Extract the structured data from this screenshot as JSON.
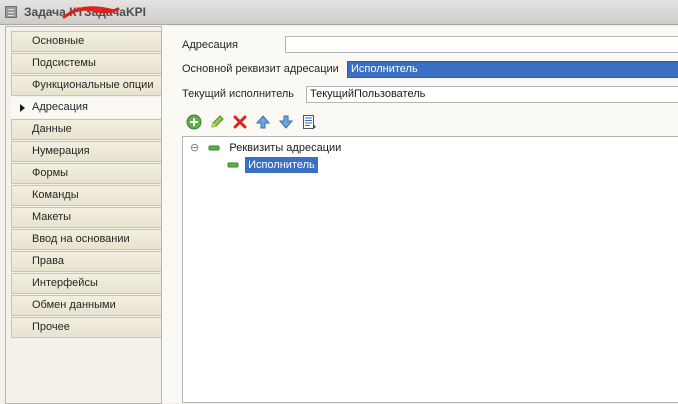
{
  "window": {
    "title_prefix": "Задача ",
    "title_struck": "КТ",
    "title_suffix": "ЗадачаKPI"
  },
  "nav": {
    "items": [
      {
        "label": "Основные"
      },
      {
        "label": "Подсистемы"
      },
      {
        "label": "Функциональные опции"
      },
      {
        "label": "Адресация"
      },
      {
        "label": "Данные"
      },
      {
        "label": "Нумерация"
      },
      {
        "label": "Формы"
      },
      {
        "label": "Команды"
      },
      {
        "label": "Макеты"
      },
      {
        "label": "Ввод на основании"
      },
      {
        "label": "Права"
      },
      {
        "label": "Интерфейсы"
      },
      {
        "label": "Обмен данными"
      },
      {
        "label": "Прочее"
      }
    ],
    "active": "Адресация"
  },
  "main": {
    "addressing_label": "Адресация",
    "addressing_value": "",
    "main_attr_label": "Основной реквизит адресации",
    "main_attr_value": "Исполнитель",
    "current_executor_label": "Текущий исполнитель",
    "current_executor_value": "ТекущийПользователь"
  },
  "toolbar": {
    "icons": [
      "add-icon",
      "edit-icon",
      "delete-icon",
      "move-up-icon",
      "move-down-icon",
      "list-icon"
    ]
  },
  "tree": {
    "root_label": "Реквизиты адресации",
    "child_label": "Исполнитель",
    "root_toggle": "⊖"
  },
  "colors": {
    "selection": "#3a6fc4",
    "panel": "#faf9f4",
    "tab": "#ebe7d4"
  }
}
